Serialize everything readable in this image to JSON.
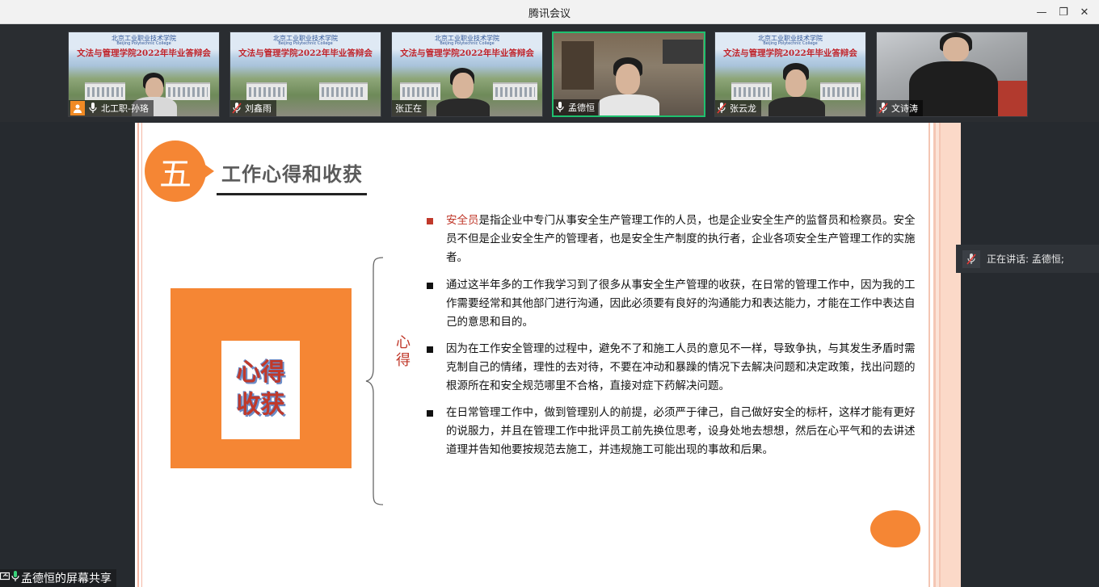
{
  "window": {
    "title": "腾讯会议",
    "minimize": "—",
    "restore": "❐",
    "close": "✕"
  },
  "banner": {
    "school": "北京工业职业技术学院",
    "school_en": "Beijing Polytechnic College",
    "title": "文法与管理学院2022年毕业答辩会"
  },
  "participants": [
    {
      "name": "北工职-孙珞",
      "mic": "on",
      "avatar": true
    },
    {
      "name": "刘鑫雨",
      "mic": "muted"
    },
    {
      "name": "张正在",
      "mic": "none"
    },
    {
      "name": "孟德恒",
      "mic": "on",
      "active": true
    },
    {
      "name": "张云龙",
      "mic": "muted"
    },
    {
      "name": "文诗涛",
      "mic": "muted"
    }
  ],
  "slide": {
    "number": "五",
    "title": "工作心得和收获",
    "box_line1": "心得",
    "box_line2": "收获",
    "brace_label": "心得",
    "bullets": [
      {
        "highlight": "安全员",
        "text": "是指企业中专门从事安全生产管理工作的人员，也是企业安全生产的监督员和检察员。安全员不但是企业安全生产的管理者，也是安全生产制度的执行者，企业各项安全生产管理工作的实施者。"
      },
      {
        "highlight": "",
        "text": "通过这半年多的工作我学习到了很多从事安全生产管理的收获，在日常的管理工作中，因为我的工作需要经常和其他部门进行沟通，因此必须要有良好的沟通能力和表达能力，才能在工作中表达自己的意思和目的。"
      },
      {
        "highlight": "",
        "text": "因为在工作安全管理的过程中，避免不了和施工人员的意见不一样，导致争执，与其发生矛盾时需克制自己的情绪，理性的去对待，不要在冲动和暴躁的情况下去解决问题和决定政策，找出问题的根源所在和安全规范哪里不合格，直接对症下药解决问题。"
      },
      {
        "highlight": "",
        "text": "在日常管理工作中，做到管理别人的前提，必须严于律己，自己做好安全的标杆，这样才能有更好的说服力，并且在管理工作中批评员工前先换位思考，设身处地去想想，然后在心平气和的去讲述道理并告知他要按规范去施工，并违规施工可能出现的事故和后果。"
      }
    ]
  },
  "speaking": {
    "label": "正在讲话: 孟德恒;"
  },
  "share": {
    "label": "孟德恒的屏幕共享"
  },
  "colors": {
    "accent_orange": "#f58634",
    "highlight_red": "#c0392b",
    "active_green": "#1fc06f"
  }
}
